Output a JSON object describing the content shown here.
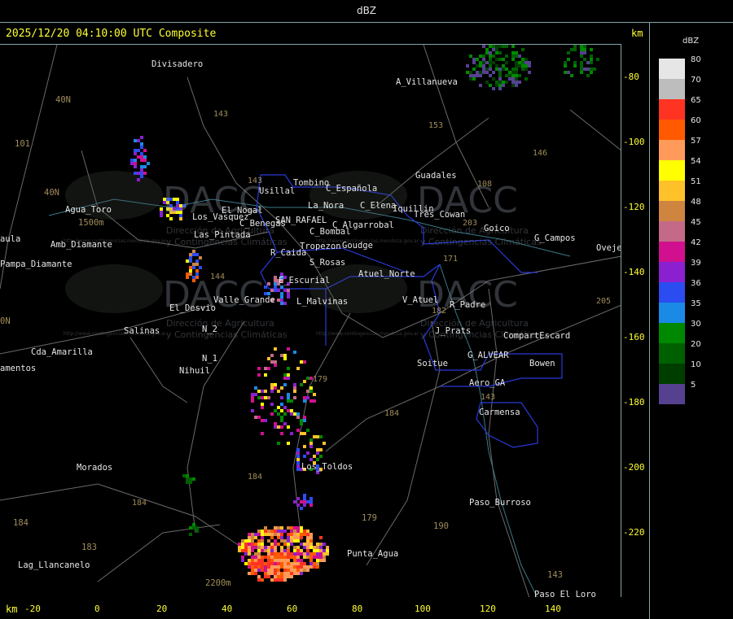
{
  "top_title": "dBZ",
  "timestamp": "2025/12/20 04:10:00 UTC Composite",
  "km_label_top": "km",
  "km_label_bottom": "km",
  "legend": {
    "title": "dBZ",
    "entries": [
      {
        "label": "80",
        "color": "#e6e6e6"
      },
      {
        "label": "70",
        "color": "#bdbdbd"
      },
      {
        "label": "65",
        "color": "#ff3322"
      },
      {
        "label": "60",
        "color": "#ff5a00"
      },
      {
        "label": "57",
        "color": "#ff9a5a"
      },
      {
        "label": "54",
        "color": "#ffff00"
      },
      {
        "label": "51",
        "color": "#ffc12a"
      },
      {
        "label": "48",
        "color": "#cd853f"
      },
      {
        "label": "45",
        "color": "#c46a88"
      },
      {
        "label": "42",
        "color": "#d0108f"
      },
      {
        "label": "39",
        "color": "#8a20d0"
      },
      {
        "label": "36",
        "color": "#2b4cf0"
      },
      {
        "label": "35",
        "color": "#1a8ae6"
      },
      {
        "label": "30",
        "color": "#008800"
      },
      {
        "label": "20",
        "color": "#006000"
      },
      {
        "label": "10",
        "color": "#003e00"
      },
      {
        "label": "5",
        "color": "#55418f"
      }
    ]
  },
  "y_ticks": [
    "-80",
    "-100",
    "-120",
    "-140",
    "-160",
    "-180",
    "-200",
    "-220"
  ],
  "x_ticks": [
    "-20",
    "0",
    "20",
    "40",
    "60",
    "80",
    "100",
    "120",
    "140"
  ],
  "places": [
    "Divisadero",
    "A_Villanueva",
    "40N",
    "101",
    "40N",
    "Usillal",
    "Tombino",
    "C_Española",
    "La_Nora",
    "C_Elena",
    "Iquillin",
    "Tres_Cowan",
    "Guadales",
    "Agua_Toro",
    "1500m",
    "Amb_Diamante",
    "aula",
    "Pampa_Diamante",
    "Los_Vasquez",
    "El_Nogal",
    "C_Benegas",
    "SAN_RAFAEL",
    "C_Algarrobal",
    "C_Bombal",
    "Goudge",
    "Goico",
    "G_Campos",
    "Ovejero",
    "Las_Pintada",
    "R_Caida",
    "Tropezon",
    "S_Rosas",
    "Atuel_Norte",
    "E_Escurial",
    "Valle_Grande",
    "L_Malvinas",
    "V_Atuel",
    "R_Padre",
    "El_Desvio",
    "Salinas",
    "N_2",
    "J_Prats",
    "CompartEscard",
    "Cda_Amarilla",
    "N_1",
    "G_ALVEAR",
    "Bowen",
    "amentos",
    "Nihuil",
    "Soitue",
    "Aero_GA",
    "Carmensa",
    "Morados",
    "Los_Toldos",
    "Paso_Burroso",
    "184",
    "Lag_Llancanelo",
    "183",
    "2200m",
    "Punta_Agua",
    "179",
    "190",
    "143",
    "Paso_El_Loro",
    "0N"
  ],
  "routes": [
    "143",
    "153",
    "146",
    "143",
    "108",
    "203",
    "171",
    "182",
    "144",
    "179",
    "184",
    "184",
    "179",
    "190",
    "143",
    "143",
    "184",
    "143",
    "205",
    "40N"
  ],
  "watermark": {
    "brand": "DACC",
    "line1": "Dirección de Agricultura",
    "line2": "y Contingencias Climáticas",
    "url": "http://www.contingencias.mendoza.gov.ar"
  }
}
